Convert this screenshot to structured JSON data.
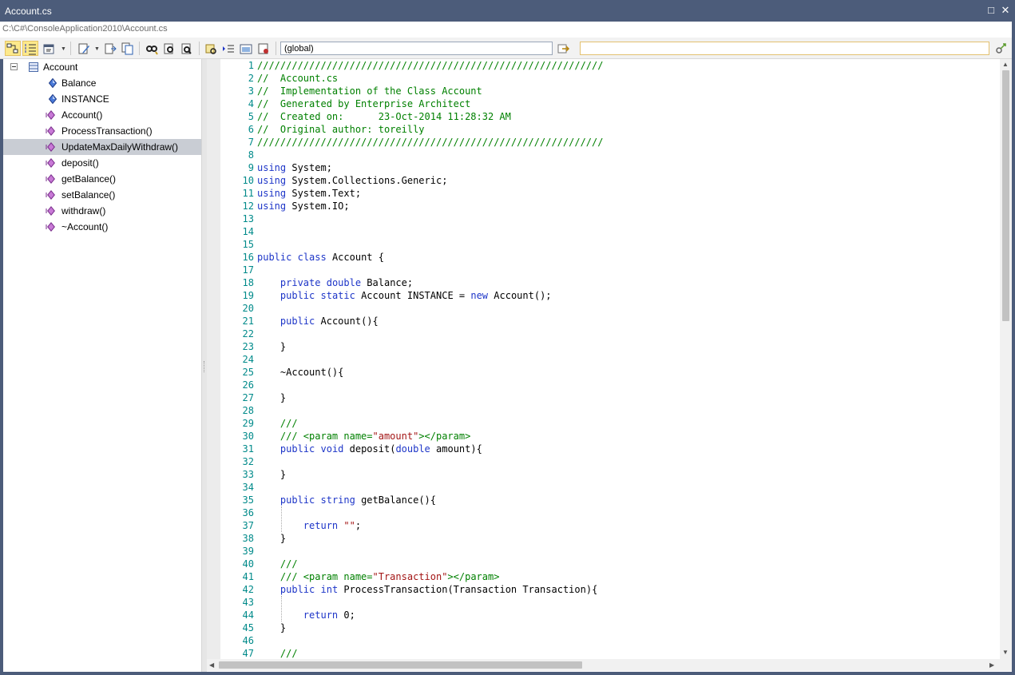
{
  "window": {
    "title": "Account.cs",
    "path": "C:\\C#\\ConsoleApplication2010\\Account.cs",
    "maximize_icon": "maximize-icon",
    "close_icon": "close-icon"
  },
  "toolbar": {
    "scope_value": "(global)",
    "find_value": "",
    "icons": [
      "sort-tree-icon",
      "numbered-list-icon",
      "properties-icon",
      "edit-icon",
      "import-icon",
      "copy-icon",
      "find-icon",
      "find-next-icon",
      "find-previous-icon",
      "toggle-bookmark-icon",
      "indent-icon",
      "view-icon",
      "breakpoint-icon",
      "go-icon",
      "search-go-icon"
    ]
  },
  "tree": {
    "root": {
      "label": "Account",
      "icon": "class-icon"
    },
    "items": [
      {
        "label": "Balance",
        "kind": "attribute"
      },
      {
        "label": "INSTANCE",
        "kind": "attribute"
      },
      {
        "label": "Account()",
        "kind": "method"
      },
      {
        "label": "ProcessTransaction()",
        "kind": "method"
      },
      {
        "label": "UpdateMaxDailyWithdraw()",
        "kind": "method",
        "selected": true
      },
      {
        "label": "deposit()",
        "kind": "method"
      },
      {
        "label": "getBalance()",
        "kind": "method"
      },
      {
        "label": "setBalance()",
        "kind": "method"
      },
      {
        "label": "withdraw()",
        "kind": "method"
      },
      {
        "label": "~Account()",
        "kind": "method"
      }
    ]
  },
  "colors": {
    "titlebar": "#4c5c7a",
    "keyword": "#1d35c8",
    "comment": "#008000",
    "string": "#a31515",
    "line_number": "#008a8a",
    "selection": "#c9cdd4"
  },
  "editor": {
    "lines": [
      {
        "n": "1",
        "tokens": [
          [
            "cm",
            "////////////////////////////////////////////////////////////"
          ]
        ]
      },
      {
        "n": "2",
        "tokens": [
          [
            "cm",
            "//  Account.cs"
          ]
        ]
      },
      {
        "n": "3",
        "tokens": [
          [
            "cm",
            "//  Implementation of the Class Account"
          ]
        ]
      },
      {
        "n": "4",
        "tokens": [
          [
            "cm",
            "//  Generated by Enterprise Architect"
          ]
        ]
      },
      {
        "n": "5",
        "tokens": [
          [
            "cm",
            "//  Created on:      23-Oct-2014 11:28:32 AM"
          ]
        ]
      },
      {
        "n": "6",
        "tokens": [
          [
            "cm",
            "//  Original author: toreilly"
          ]
        ]
      },
      {
        "n": "7",
        "tokens": [
          [
            "cm",
            "////////////////////////////////////////////////////////////"
          ]
        ]
      },
      {
        "n": "8",
        "tokens": []
      },
      {
        "n": "9",
        "tokens": [
          [
            "kw",
            "using"
          ],
          [
            "",
            " System;"
          ]
        ]
      },
      {
        "n": "10",
        "tokens": [
          [
            "kw",
            "using"
          ],
          [
            "",
            " System.Collections.Generic;"
          ]
        ]
      },
      {
        "n": "11",
        "tokens": [
          [
            "kw",
            "using"
          ],
          [
            "",
            " System.Text;"
          ]
        ]
      },
      {
        "n": "12",
        "tokens": [
          [
            "kw",
            "using"
          ],
          [
            "",
            " System.IO;"
          ]
        ]
      },
      {
        "n": "13",
        "tokens": []
      },
      {
        "n": "14",
        "tokens": []
      },
      {
        "n": "15",
        "tokens": []
      },
      {
        "n": "16",
        "tokens": [
          [
            "kw",
            "public"
          ],
          [
            "",
            " "
          ],
          [
            "kw",
            "class"
          ],
          [
            "",
            " Account {"
          ]
        ]
      },
      {
        "n": "17",
        "tokens": []
      },
      {
        "n": "18",
        "tokens": [
          [
            "",
            "    "
          ],
          [
            "kw",
            "private"
          ],
          [
            "",
            " "
          ],
          [
            "kw",
            "double"
          ],
          [
            "",
            " Balance;"
          ]
        ]
      },
      {
        "n": "19",
        "tokens": [
          [
            "",
            "    "
          ],
          [
            "kw",
            "public"
          ],
          [
            "",
            " "
          ],
          [
            "kw",
            "static"
          ],
          [
            "",
            " Account INSTANCE = "
          ],
          [
            "kw",
            "new"
          ],
          [
            "",
            " Account();"
          ]
        ]
      },
      {
        "n": "20",
        "tokens": []
      },
      {
        "n": "21",
        "tokens": [
          [
            "",
            "    "
          ],
          [
            "kw",
            "public"
          ],
          [
            "",
            " Account(){"
          ]
        ]
      },
      {
        "n": "22",
        "tokens": []
      },
      {
        "n": "23",
        "tokens": [
          [
            "",
            "    }"
          ]
        ]
      },
      {
        "n": "24",
        "tokens": []
      },
      {
        "n": "25",
        "tokens": [
          [
            "",
            "    ~Account(){"
          ]
        ]
      },
      {
        "n": "26",
        "tokens": []
      },
      {
        "n": "27",
        "tokens": [
          [
            "",
            "    }"
          ]
        ]
      },
      {
        "n": "28",
        "tokens": []
      },
      {
        "n": "29",
        "tokens": [
          [
            "",
            "    "
          ],
          [
            "cm",
            "///"
          ]
        ]
      },
      {
        "n": "30",
        "tokens": [
          [
            "",
            "    "
          ],
          [
            "cm",
            "/// <param name="
          ],
          [
            "st",
            "\"amount\""
          ],
          [
            "cm",
            "></param>"
          ]
        ]
      },
      {
        "n": "31",
        "tokens": [
          [
            "",
            "    "
          ],
          [
            "kw",
            "public"
          ],
          [
            "",
            " "
          ],
          [
            "kw",
            "void"
          ],
          [
            "",
            " deposit("
          ],
          [
            "kw",
            "double"
          ],
          [
            "",
            " amount){"
          ]
        ]
      },
      {
        "n": "32",
        "tokens": []
      },
      {
        "n": "33",
        "tokens": [
          [
            "",
            "    }"
          ]
        ]
      },
      {
        "n": "34",
        "tokens": []
      },
      {
        "n": "35",
        "tokens": [
          [
            "",
            "    "
          ],
          [
            "kw",
            "public"
          ],
          [
            "",
            " "
          ],
          [
            "kw",
            "string"
          ],
          [
            "",
            " getBalance(){"
          ]
        ]
      },
      {
        "n": "36",
        "tokens": []
      },
      {
        "n": "37",
        "tokens": [
          [
            "",
            "        "
          ],
          [
            "kw",
            "return"
          ],
          [
            "",
            " "
          ],
          [
            "st",
            "\"\""
          ],
          [
            "",
            ";"
          ]
        ]
      },
      {
        "n": "38",
        "tokens": [
          [
            "",
            "    }"
          ]
        ]
      },
      {
        "n": "39",
        "tokens": []
      },
      {
        "n": "40",
        "tokens": [
          [
            "",
            "    "
          ],
          [
            "cm",
            "///"
          ]
        ]
      },
      {
        "n": "41",
        "tokens": [
          [
            "",
            "    "
          ],
          [
            "cm",
            "/// <param name="
          ],
          [
            "st",
            "\"Transaction\""
          ],
          [
            "cm",
            "></param>"
          ]
        ]
      },
      {
        "n": "42",
        "tokens": [
          [
            "",
            "    "
          ],
          [
            "kw",
            "public"
          ],
          [
            "",
            " "
          ],
          [
            "kw",
            "int"
          ],
          [
            "",
            " ProcessTransaction(Transaction Transaction){"
          ]
        ]
      },
      {
        "n": "43",
        "tokens": []
      },
      {
        "n": "44",
        "tokens": [
          [
            "",
            "        "
          ],
          [
            "kw",
            "return"
          ],
          [
            "",
            " 0;"
          ]
        ]
      },
      {
        "n": "45",
        "tokens": [
          [
            "",
            "    }"
          ]
        ]
      },
      {
        "n": "46",
        "tokens": []
      },
      {
        "n": "47",
        "tokens": [
          [
            "",
            "    "
          ],
          [
            "cm",
            "///"
          ]
        ]
      }
    ]
  }
}
